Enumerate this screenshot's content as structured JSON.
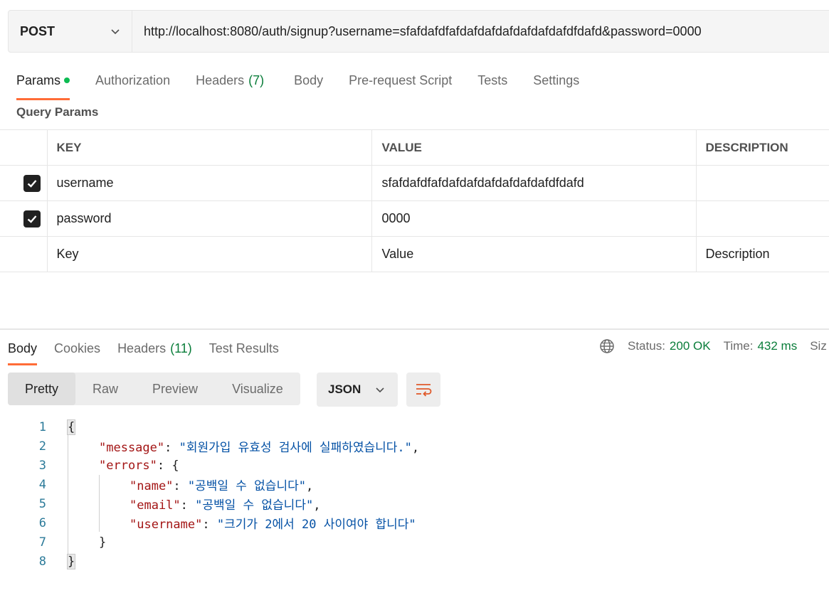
{
  "request": {
    "method": "POST",
    "url": "http://localhost:8080/auth/signup?username=sfafdafdfafdafdafdafdafdafdafdfdafd&password=0000"
  },
  "request_tabs": {
    "params": "Params",
    "authorization": "Authorization",
    "headers": "Headers",
    "headers_count": "(7)",
    "body": "Body",
    "pre_request": "Pre-request Script",
    "tests": "Tests",
    "settings": "Settings"
  },
  "query_params": {
    "title": "Query Params",
    "columns": {
      "key": "KEY",
      "value": "VALUE",
      "description": "DESCRIPTION"
    },
    "rows": [
      {
        "key": "username",
        "value": "sfafdafdfafdafdafdafdafdafdafdfdafd",
        "description": "",
        "checked": true
      },
      {
        "key": "password",
        "value": "0000",
        "description": "",
        "checked": true
      }
    ],
    "placeholders": {
      "key": "Key",
      "value": "Value",
      "description": "Description"
    }
  },
  "response_tabs": {
    "body": "Body",
    "cookies": "Cookies",
    "headers": "Headers",
    "headers_count": "(11)",
    "test_results": "Test Results"
  },
  "status": {
    "status_label": "Status:",
    "status_value": "200 OK",
    "time_label": "Time:",
    "time_value": "432 ms",
    "size_label": "Siz"
  },
  "view_modes": {
    "pretty": "Pretty",
    "raw": "Raw",
    "preview": "Preview",
    "visualize": "Visualize"
  },
  "format": "JSON",
  "code_lines": {
    "n1": "1",
    "n2": "2",
    "n3": "3",
    "n4": "4",
    "n5": "5",
    "n6": "6",
    "n7": "7",
    "n8": "8",
    "open": "{",
    "close": "}",
    "message_key": "\"message\"",
    "message_val": "\"회원가입 유효성 검사에 실패하였습니다.\"",
    "errors_key": "\"errors\"",
    "name_key": "\"name\"",
    "name_val": "\"공백일 수 없습니다\"",
    "email_key": "\"email\"",
    "email_val": "\"공백일 수 없습니다\"",
    "username_key": "\"username\"",
    "username_val": "\"크기가 2에서 20 사이여야 합니다\""
  },
  "colors": {
    "accent": "#ff6c37",
    "success": "#0a7d3a",
    "dot": "#0cbb52"
  }
}
